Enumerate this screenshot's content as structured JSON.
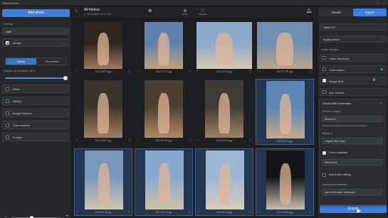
{
  "window": {
    "title": "Retouch4me"
  },
  "left": {
    "primary_button": "Add photo",
    "sort_label": "Sort by",
    "sort_value": "Date",
    "group_label": "Group",
    "seg_a": "Similar",
    "seg_b": "Processed",
    "similarity_label": "Degree of similarity: 90%",
    "filters": [
      "Stars",
      "Rating",
      "Image features",
      "Face features",
      "Folders"
    ]
  },
  "center": {
    "title": "All folders",
    "subtitle": "6 / 26 photos | 23.65 GB",
    "header_icons": {
      "settings": "gear-icon",
      "reset": "Photo",
      "favorite": "Favorite",
      "bell": "bell-icon"
    },
    "photos": [
      {
        "name": "DSC09873.jpg",
        "colors": [
          "#2d2621",
          "#a07a62"
        ]
      },
      {
        "name": "DSC07747.jpg",
        "colors": [
          "#5e82ad",
          "#c2a17a"
        ]
      },
      {
        "name": "DSC04754.jpg",
        "colors": [
          "#8da9cc",
          "#d7c9b3"
        ]
      },
      {
        "name": "DSC07781.jpg",
        "colors": [
          "#6f8fb3",
          "#bba58a"
        ]
      },
      {
        "name": "DSC09997.jpg",
        "colors": [
          "#3a332b",
          "#a58060"
        ]
      },
      {
        "name": "DSC09753.jpg",
        "colors": [
          "#4b3f32",
          "#b28a65"
        ]
      },
      {
        "name": "DSC09325.jpg",
        "colors": [
          "#3e3a34",
          "#9e8064"
        ]
      },
      {
        "name": "DSC05773.jpg",
        "colors": [
          "#5c86b6",
          "#c3aa8b"
        ]
      },
      {
        "name": "DSC09738.jpg",
        "colors": [
          "#7a98bd",
          "#d3c4b3"
        ]
      },
      {
        "name": "DSC05745.jpg",
        "colors": [
          "#87a9cf",
          "#cfc0ad"
        ]
      },
      {
        "name": "DSC09745.jpg",
        "colors": [
          "#9db6d4",
          "#d8ccbc"
        ]
      },
      {
        "name": "DSC02064.jpg",
        "colors": [
          "#121417",
          "#c9bcb0"
        ]
      }
    ]
  },
  "right": {
    "tab_details": "Details",
    "tab_export": "Export",
    "tasks": "Tasks 2/2",
    "apply_preset": "Apply preset",
    "active_plugins_label": "Active plugins",
    "plugins": [
      {
        "name": "Clean Backdrop",
        "on": false
      },
      {
        "name": "Color Match",
        "on": false
      },
      {
        "name": "Dodge Burn",
        "on": true
      },
      {
        "name": "Eye Vessels",
        "on": false
      }
    ],
    "export_button": "Export"
  },
  "popup": {
    "title": "Export With Correction",
    "photos_label": "Photos to export",
    "photos_value": "Selected 1",
    "photos_note": "Rejected photos won't be exported or exported",
    "export_to_label": "Export to",
    "export_to_value": "Original files folder",
    "put_in_subfolder": "Put in subfolder",
    "subfolder_value": "Retouched",
    "add_to_catalog": "Add to this catalog",
    "naming_label": "Naming and renaming",
    "naming_value": "Add to file name: retouched"
  }
}
